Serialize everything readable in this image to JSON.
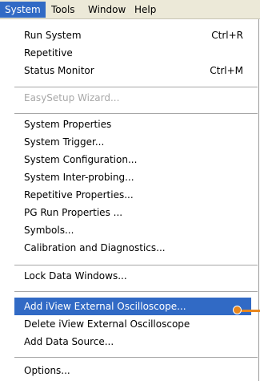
{
  "menubar": {
    "items": [
      {
        "label": "System",
        "active": true
      },
      {
        "label": "Tools",
        "active": false
      },
      {
        "label": "Window",
        "active": false
      },
      {
        "label": "Help",
        "active": false
      }
    ]
  },
  "menu": {
    "groups": [
      [
        {
          "label": "Run System",
          "shortcut": "Ctrl+R",
          "enabled": true,
          "highlighted": false
        },
        {
          "label": "Repetitive",
          "shortcut": "",
          "enabled": true,
          "highlighted": false
        },
        {
          "label": "Status Monitor",
          "shortcut": "Ctrl+M",
          "enabled": true,
          "highlighted": false
        }
      ],
      [
        {
          "label": "EasySetup Wizard...",
          "shortcut": "",
          "enabled": false,
          "highlighted": false
        }
      ],
      [
        {
          "label": "System Properties",
          "shortcut": "",
          "enabled": true,
          "highlighted": false
        },
        {
          "label": "System Trigger...",
          "shortcut": "",
          "enabled": true,
          "highlighted": false
        },
        {
          "label": "System Configuration...",
          "shortcut": "",
          "enabled": true,
          "highlighted": false
        },
        {
          "label": "System Inter-probing...",
          "shortcut": "",
          "enabled": true,
          "highlighted": false
        },
        {
          "label": "Repetitive Properties...",
          "shortcut": "",
          "enabled": true,
          "highlighted": false
        },
        {
          "label": "PG Run Properties ...",
          "shortcut": "",
          "enabled": true,
          "highlighted": false
        },
        {
          "label": "Symbols...",
          "shortcut": "",
          "enabled": true,
          "highlighted": false
        },
        {
          "label": "Calibration and Diagnostics...",
          "shortcut": "",
          "enabled": true,
          "highlighted": false
        }
      ],
      [
        {
          "label": "Lock Data Windows...",
          "shortcut": "",
          "enabled": true,
          "highlighted": false
        }
      ],
      [
        {
          "label": "Add iView External Oscilloscope...",
          "shortcut": "",
          "enabled": true,
          "highlighted": true
        },
        {
          "label": "Delete iView External Oscilloscope",
          "shortcut": "",
          "enabled": true,
          "highlighted": false
        },
        {
          "label": "Add Data Source...",
          "shortcut": "",
          "enabled": true,
          "highlighted": false
        }
      ],
      [
        {
          "label": "Options...",
          "shortcut": "",
          "enabled": true,
          "highlighted": false
        }
      ]
    ]
  },
  "colors": {
    "highlight": "#316ac5",
    "disabled_text": "#a8a8a8",
    "callout": "#e8871e"
  }
}
